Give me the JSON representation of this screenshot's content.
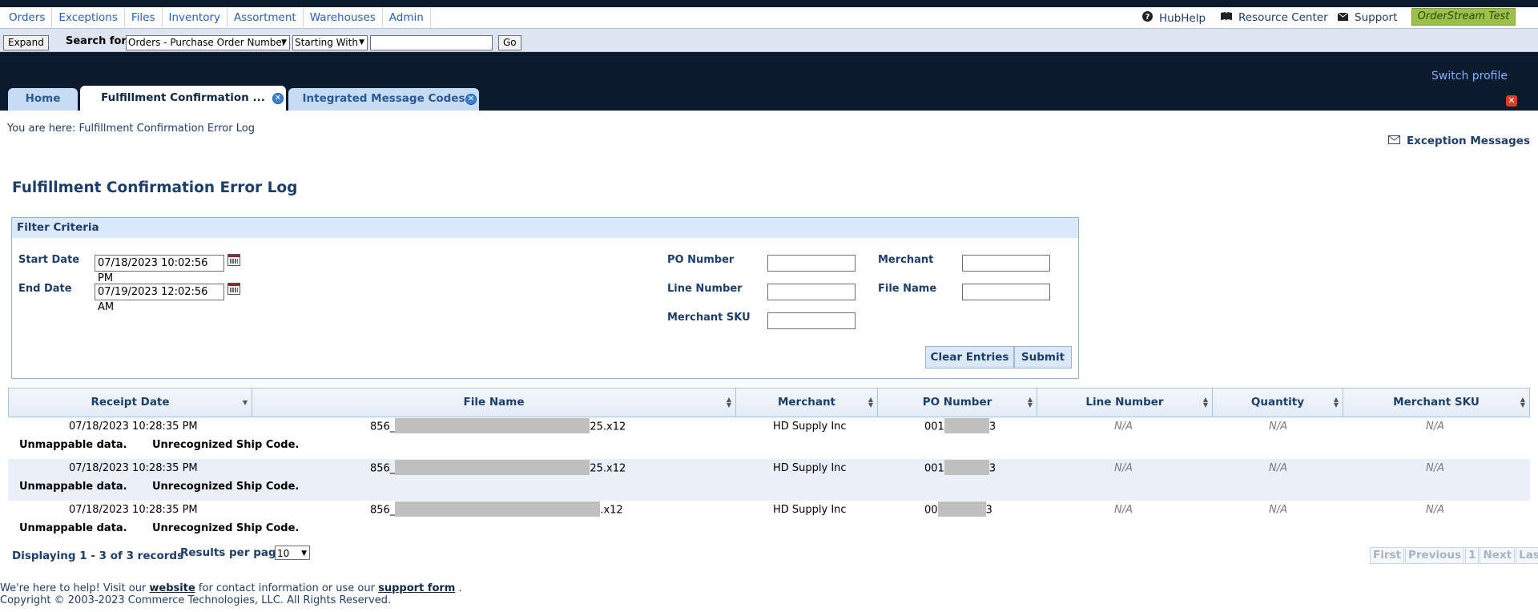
{
  "menu": [
    "Orders",
    "Exceptions",
    "Files",
    "Inventory",
    "Assortment",
    "Warehouses",
    "Admin"
  ],
  "utility": {
    "hubhelp": "HubHelp",
    "resource_center": "Resource Center",
    "support": "Support",
    "env_badge": "OrderStream Test"
  },
  "search": {
    "expand": "Expand",
    "label": "Search for",
    "type": "Orders - Purchase Order Number",
    "mode": "Starting With",
    "value": "",
    "go": "Go"
  },
  "header": {
    "switch_profile": "Switch profile"
  },
  "tabs": [
    {
      "label": "Home"
    },
    {
      "label": "Fulfillment Confirmation ..."
    },
    {
      "label": "Integrated Message Codes"
    }
  ],
  "breadcrumb": "You are here: Fulfillment Confirmation Error Log",
  "exception_messages": "Exception Messages",
  "page_title": "Fulfillment Confirmation Error Log",
  "filter": {
    "heading": "Filter Criteria",
    "start_date_label": "Start Date",
    "start_date": "07/18/2023 10:02:56 PM",
    "end_date_label": "End Date",
    "end_date": "07/19/2023 12:02:56 AM",
    "po_number_label": "PO Number",
    "line_number_label": "Line Number",
    "merchant_sku_label": "Merchant SKU",
    "merchant_label": "Merchant",
    "file_name_label": "File Name",
    "clear": "Clear Entries",
    "submit": "Submit"
  },
  "grid": {
    "columns": [
      "Receipt Date",
      "File Name",
      "Merchant",
      "PO Number",
      "Line Number",
      "Quantity",
      "Merchant SKU"
    ],
    "rows": [
      {
        "date": "07/18/2023 10:28:35 PM",
        "file_prefix": "856_",
        "file_suffix": "25.x12",
        "merchant": "HD Supply Inc",
        "po_prefix": "001",
        "po_suffix": "3",
        "line": "N/A",
        "qty": "N/A",
        "sku": "N/A",
        "error_type": "Unmappable data.",
        "error_msg": "Unrecognized Ship Code."
      },
      {
        "date": "07/18/2023 10:28:35 PM",
        "file_prefix": "856_",
        "file_suffix": "25.x12",
        "merchant": "HD Supply Inc",
        "po_prefix": "001",
        "po_suffix": "3",
        "line": "N/A",
        "qty": "N/A",
        "sku": "N/A",
        "error_type": "Unmappable data.",
        "error_msg": "Unrecognized Ship Code."
      },
      {
        "date": "07/18/2023 10:28:35 PM",
        "file_prefix": "856_",
        "file_suffix": ".x12",
        "merchant": "HD Supply Inc",
        "po_prefix": "00",
        "po_suffix": "3",
        "line": "N/A",
        "qty": "N/A",
        "sku": "N/A",
        "error_type": "Unmappable data.",
        "error_msg": "Unrecognized Ship Code."
      }
    ]
  },
  "pager": {
    "info": "Displaying 1 - 3 of 3 records",
    "rpp_label": "Results per page",
    "rpp": "10",
    "first": "First",
    "previous": "Previous",
    "page": "1",
    "next": "Next",
    "last": "Last"
  },
  "footer": {
    "t1": "We're here to help! Visit our ",
    "website": "website",
    "t2": " for contact information or use our ",
    "support_form": "support form",
    "t3": " .",
    "copyright": "Copyright © 2003-2023 Commerce Technologies, LLC. All Rights Reserved."
  }
}
